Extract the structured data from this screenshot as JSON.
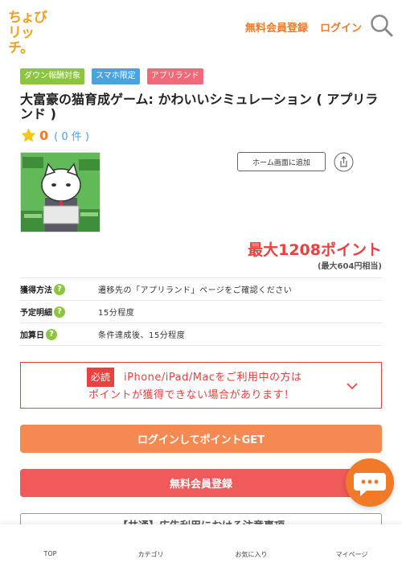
{
  "header": {
    "logo_line1": "ちょび",
    "logo_line2": "リッチ。",
    "register_label": "無料会員登録",
    "login_label": "ログイン",
    "search_icon": "search-icon"
  },
  "tags": [
    "ダウン報酬対象",
    "スマホ限定",
    "アプリランド"
  ],
  "colors": {
    "accent": "#f07a28",
    "red": "#e8413e",
    "green": "#8cc63f",
    "blue": "#4aa3df",
    "pink": "#f06a7a"
  },
  "offer": {
    "title": "大富豪の猫育成ゲーム: かわいいシミュレーション ( アプリランド )",
    "rating_score": "0",
    "rating_count": "( 0 件 )",
    "home_button_label": "ホーム画面に追加",
    "points_main": "最大1208ポイント",
    "points_sub": "(最大604円相当)"
  },
  "info": [
    {
      "key": "獲得方法",
      "value": "遷移先の「アプリランド」ページをご確認ください"
    },
    {
      "key": "予定明細",
      "value": "15分程度"
    },
    {
      "key": "加算日",
      "value": "条件達成後、15分程度"
    }
  ],
  "notice": {
    "badge": "必読",
    "line1": "iPhone/iPad/Macをご利用中の方は",
    "line2": "ポイントが獲得できない場合があります！"
  },
  "buttons": {
    "login_get": "ログインしてポイントGET",
    "register": "無料会員登録"
  },
  "notice2": "【共通】広告利用における注意事項",
  "bottom_nav": [
    "TOP",
    "カテゴリ",
    "お気に入り",
    "マイページ"
  ]
}
